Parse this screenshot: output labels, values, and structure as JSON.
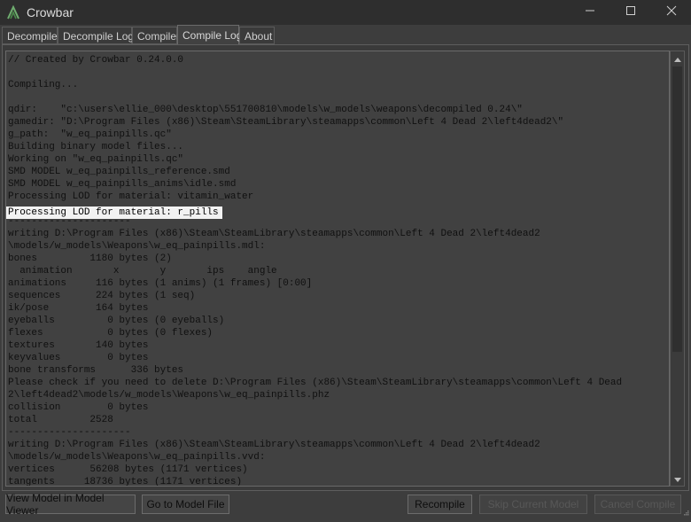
{
  "window": {
    "title": "Crowbar"
  },
  "tabs": [
    {
      "label": "Decompiler"
    },
    {
      "label": "Decompile Log"
    },
    {
      "label": "Compiler"
    },
    {
      "label": "Compile Log"
    },
    {
      "label": "About"
    }
  ],
  "active_tab": "Compile Log",
  "log": {
    "selected_line_index": 12,
    "lines": [
      "// Created by Crowbar 0.24.0.0",
      "",
      "Compiling...",
      "",
      "qdir:    \"c:\\users\\ellie_000\\desktop\\551700810\\models\\w_models\\weapons\\decompiled 0.24\\\"",
      "gamedir: \"D:\\Program Files (x86)\\Steam\\SteamLibrary\\steamapps\\common\\Left 4 Dead 2\\left4dead2\\\"",
      "g_path:  \"w_eq_painpills.qc\"",
      "Building binary model files...",
      "Working on \"w_eq_painpills.qc\"",
      "SMD MODEL w_eq_painpills_reference.smd",
      "SMD MODEL w_eq_painpills_anims\\idle.smd",
      "Processing LOD for material: vitamin_water",
      "Processing LOD for material: r_pills",
      "---------------------",
      "writing D:\\Program Files (x86)\\Steam\\SteamLibrary\\steamapps\\common\\Left 4 Dead 2\\left4dead2",
      "\\models/w_models\\Weapons\\w_eq_painpills.mdl:",
      "bones         1180 bytes (2)",
      "  animation       x       y       ips    angle",
      "animations     116 bytes (1 anims) (1 frames) [0:00]",
      "sequences      224 bytes (1 seq)",
      "ik/pose        164 bytes",
      "eyeballs         0 bytes (0 eyeballs)",
      "flexes           0 bytes (0 flexes)",
      "textures       140 bytes",
      "keyvalues        0 bytes",
      "bone transforms      336 bytes",
      "Please check if you need to delete D:\\Program Files (x86)\\Steam\\SteamLibrary\\steamapps\\common\\Left 4 Dead",
      "2\\left4dead2\\models/w_models\\Weapons\\w_eq_painpills.phz",
      "collision        0 bytes",
      "total         2528",
      "---------------------",
      "writing D:\\Program Files (x86)\\Steam\\SteamLibrary\\steamapps\\common\\Left 4 Dead 2\\left4dead2",
      "\\models/w_models\\Weapons\\w_eq_painpills.vvd:",
      "vertices      56208 bytes (1171 vertices)",
      "tangents     18736 bytes (1171 vertices)"
    ]
  },
  "buttons": {
    "view_model": "View Model in Model Viewer",
    "go_to_model_file": "Go to Model File",
    "recompile": "Recompile",
    "skip_current_model": "Skip Current Model",
    "cancel_compile": "Cancel Compile"
  },
  "colors": {
    "background": "#3d3d3d",
    "log_background": "#414141",
    "selection": "#f2f2f2",
    "accent_icon": "#5aa05a"
  },
  "icons": [
    "crowbar-app-icon",
    "minimize-icon",
    "maximize-icon",
    "close-icon",
    "scroll-up-icon",
    "scroll-down-icon",
    "size-grip-icon"
  ]
}
